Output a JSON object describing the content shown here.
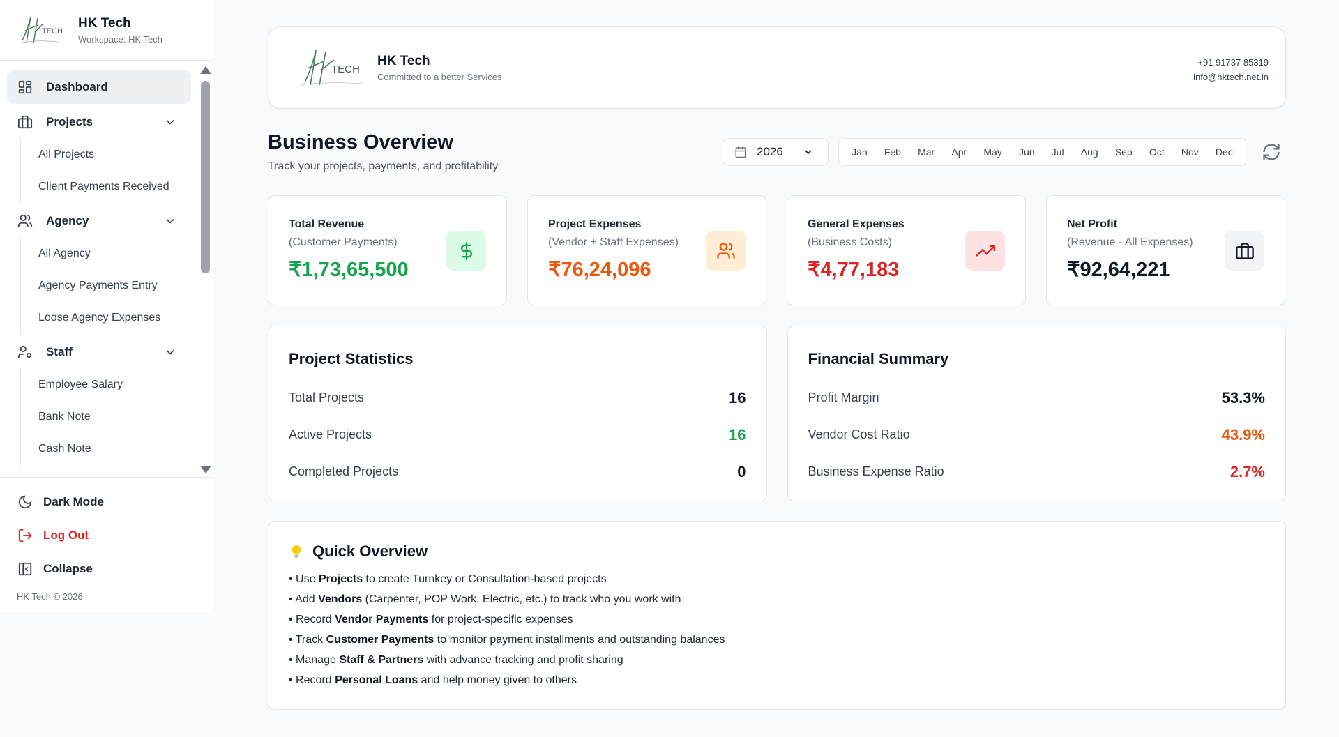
{
  "brand": {
    "name": "HK Tech",
    "workspace": "Workspace: HK Tech",
    "logo_text": "TECH"
  },
  "nav": {
    "dashboard": "Dashboard",
    "projects": {
      "label": "Projects",
      "items": [
        "All Projects",
        "Client Payments Received"
      ]
    },
    "agency": {
      "label": "Agency",
      "items": [
        "All Agency",
        "Agency Payments Entry",
        "Loose Agency Expenses"
      ]
    },
    "staff": {
      "label": "Staff",
      "items": [
        "Employee Salary",
        "Bank Note",
        "Cash Note"
      ]
    }
  },
  "footer": {
    "dark_mode": "Dark Mode",
    "logout": "Log Out",
    "collapse": "Collapse",
    "copyright": "HK Tech © 2026"
  },
  "company": {
    "name": "HK Tech",
    "tagline": "Committed to a better Services",
    "phone": "+91 91737 85319",
    "email": "info@hktech.net.in"
  },
  "overview": {
    "title": "Business Overview",
    "subtitle": "Track your projects, payments, and profitability",
    "year": "2026",
    "months": [
      "Jan",
      "Feb",
      "Mar",
      "Apr",
      "May",
      "Jun",
      "Jul",
      "Aug",
      "Sep",
      "Oct",
      "Nov",
      "Dec"
    ]
  },
  "cards": [
    {
      "label": "Total Revenue",
      "sub": "(Customer Payments)",
      "value": "₹1,73,65,500",
      "color": "#16a34a",
      "icon": "dollar-icon",
      "icon_bg": "#dcfce7"
    },
    {
      "label": "Project Expenses",
      "sub": "(Vendor + Staff Expenses)",
      "value": "₹76,24,096",
      "color": "#ea580c",
      "icon": "users-icon",
      "icon_bg": "#ffedd5"
    },
    {
      "label": "General Expenses",
      "sub": "(Business Costs)",
      "value": "₹4,77,183",
      "color": "#dc2626",
      "icon": "trending-up-icon",
      "icon_bg": "#fee2e2"
    },
    {
      "label": "Net Profit",
      "sub": "(Revenue - All Expenses)",
      "value": "₹92,64,221",
      "color": "#111827",
      "icon": "briefcase-icon",
      "icon_bg": "#f3f4f6"
    }
  ],
  "project_stats": {
    "title": "Project Statistics",
    "rows": [
      {
        "label": "Total Projects",
        "value": "16",
        "color": "#111827"
      },
      {
        "label": "Active Projects",
        "value": "16",
        "color": "#16a34a"
      },
      {
        "label": "Completed Projects",
        "value": "0",
        "color": "#111827"
      }
    ]
  },
  "financial_summary": {
    "title": "Financial Summary",
    "rows": [
      {
        "label": "Profit Margin",
        "value": "53.3%",
        "color": "#111827"
      },
      {
        "label": "Vendor Cost Ratio",
        "value": "43.9%",
        "color": "#ea580c"
      },
      {
        "label": "Business Expense Ratio",
        "value": "2.7%",
        "color": "#dc2626"
      }
    ]
  },
  "quick": {
    "title": "Quick Overview",
    "lines": [
      {
        "pre": "• Use ",
        "bold": "Projects",
        "post": " to create Turnkey or Consultation-based projects"
      },
      {
        "pre": "• Add ",
        "bold": "Vendors",
        "post": " (Carpenter, POP Work, Electric, etc.) to track who you work with"
      },
      {
        "pre": "• Record ",
        "bold": "Vendor Payments",
        "post": " for project-specific expenses"
      },
      {
        "pre": "• Track ",
        "bold": "Customer Payments",
        "post": " to monitor payment installments and outstanding balances"
      },
      {
        "pre": "• Manage ",
        "bold": "Staff & Partners",
        "post": " with advance tracking and profit sharing"
      },
      {
        "pre": "• Record ",
        "bold": "Personal Loans",
        "post": " and help money given to others"
      }
    ]
  }
}
